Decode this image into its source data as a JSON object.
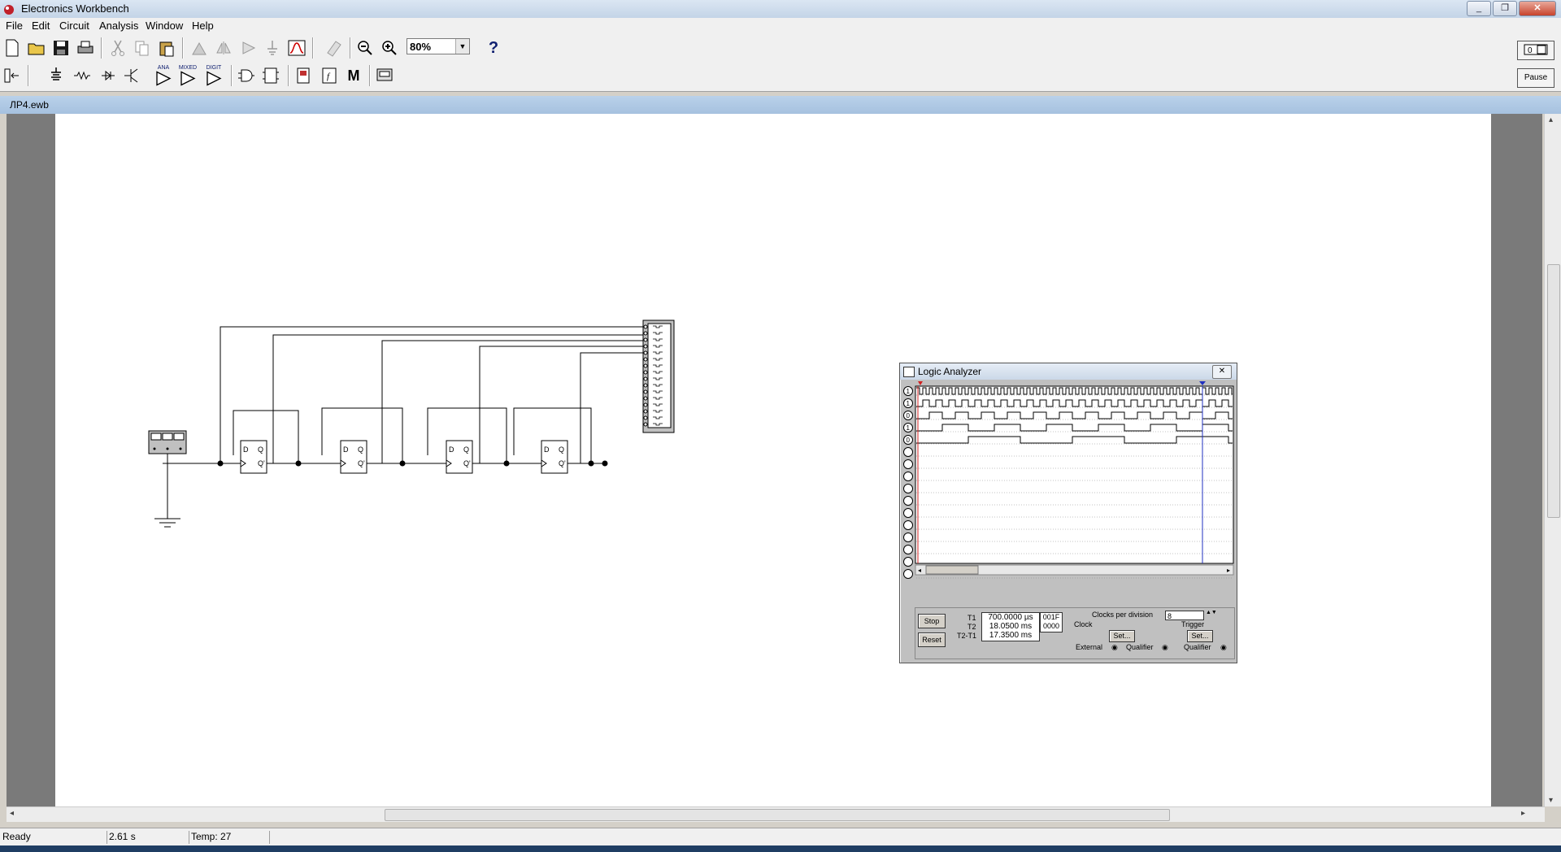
{
  "window": {
    "title": "Electronics Workbench",
    "controls": [
      "_",
      "❐",
      "✕"
    ]
  },
  "menu": [
    "File",
    "Edit",
    "Circuit",
    "Analysis",
    "Window",
    "Help"
  ],
  "toolbar": {
    "zoom": "80%",
    "help": "?",
    "pause_label": "Pause"
  },
  "parts_toolbar": {
    "ana": "ANA",
    "mixed": "MIXED",
    "digit": "DIGIT",
    "meter_m": "M",
    "func_f": "f"
  },
  "document": {
    "title": "ЛР4.ewb"
  },
  "circuit": {
    "flipflop_labels": {
      "d": "D",
      "q": "Q",
      "qbar": "Q'"
    },
    "source_labels": {
      "minus": "-",
      "plus": "+"
    }
  },
  "logic_analyzer": {
    "title": "Logic Analyzer",
    "channel_values": [
      "1",
      "1",
      "0",
      "1",
      "0",
      "",
      "",
      "",
      "",
      "",
      "",
      "",
      "",
      "",
      "",
      ""
    ],
    "buttons": {
      "stop": "Stop",
      "reset": "Reset",
      "set_clock": "Set...",
      "set_trigger": "Set..."
    },
    "times": {
      "t1_label": "T1",
      "t2_label": "T2",
      "diff_label": "T2-T1",
      "t1": "700.0000 µs",
      "t2": "18.0500 ms",
      "diff": "17.3500 ms"
    },
    "hex": {
      "a": "001F",
      "b": "0000"
    },
    "clock": {
      "clocks_per_division_label": "Clocks per division",
      "clocks_per_division": "8",
      "clock_label": "Clock",
      "external_label": "External",
      "qualifier_label": "Qualifier"
    },
    "trigger": {
      "label": "Trigger",
      "qualifier_label": "Qualifier"
    }
  },
  "status": {
    "ready": "Ready",
    "time": "2.61 s",
    "temp": "Temp:  27"
  }
}
